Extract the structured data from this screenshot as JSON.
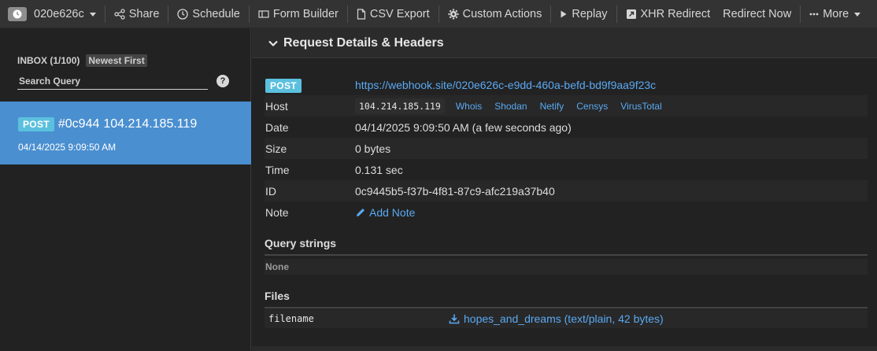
{
  "toolbar": {
    "token_label": "020e626c",
    "share_label": "Share",
    "schedule_label": "Schedule",
    "form_builder_label": "Form Builder",
    "csv_export_label": "CSV Export",
    "custom_actions_label": "Custom Actions",
    "replay_label": "Replay",
    "xhr_redirect_label": "XHR Redirect",
    "redirect_now_label": "Redirect Now",
    "more_label": "More"
  },
  "sidebar": {
    "inbox_label": "INBOX (1/100)",
    "sort_label": "Newest First",
    "search_placeholder": "Search Query",
    "help_label": "?",
    "requests": [
      {
        "method": "POST",
        "id_short": "#0c944",
        "ip": "104.214.185.119",
        "timestamp": "04/14/2025 9:09:50 AM"
      }
    ]
  },
  "panel": {
    "title": "Request Details & Headers",
    "method": "POST",
    "url": "https://webhook.site/020e626c-e9dd-460a-befd-bd9f9aa9f23c",
    "host_label": "Host",
    "host_ip": "104.214.185.119",
    "host_links": [
      "Whois",
      "Shodan",
      "Netify",
      "Censys",
      "VirusTotal"
    ],
    "date_label": "Date",
    "date_value": "04/14/2025 9:09:50 AM (a few seconds ago)",
    "size_label": "Size",
    "size_value": "0 bytes",
    "time_label": "Time",
    "time_value": "0.131 sec",
    "id_label": "ID",
    "id_value": "0c9445b5-f37b-4f81-87c9-afc219a37b40",
    "note_label": "Note",
    "add_note_label": "Add Note",
    "query_title": "Query strings",
    "query_none": "None",
    "files_title": "Files",
    "file_key": "filename",
    "file_value": "hopes_and_dreams (text/plain, 42 bytes)"
  }
}
